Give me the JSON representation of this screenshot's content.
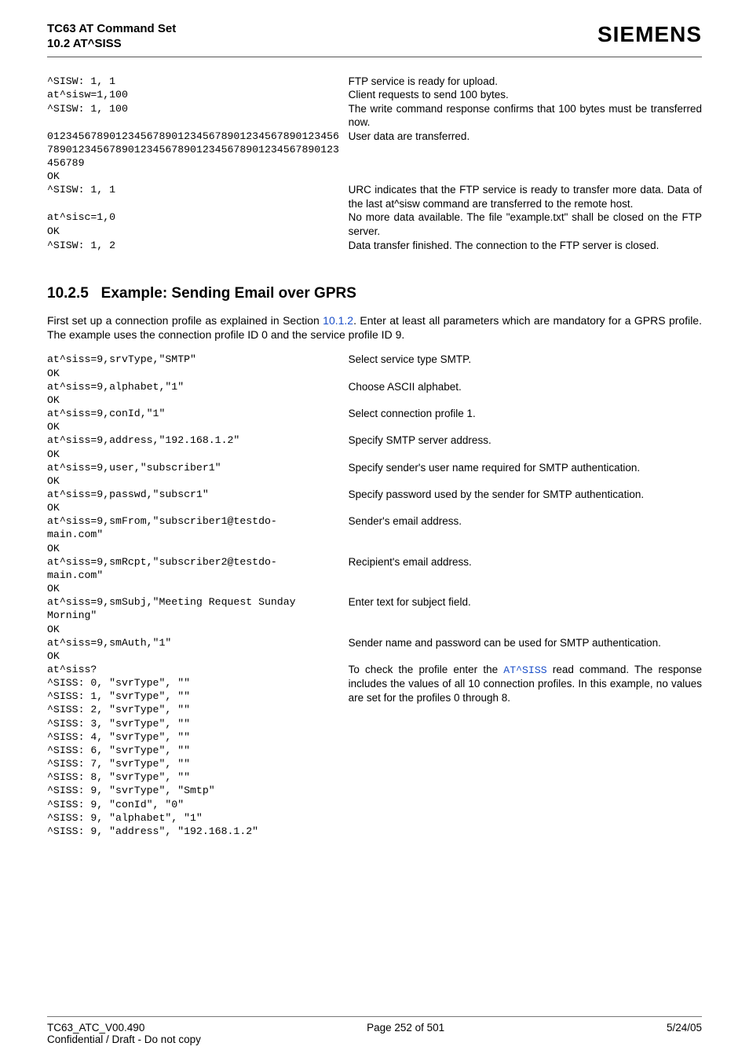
{
  "header": {
    "doc_title": "TC63 AT Command Set",
    "section_ref": "10.2 AT^SISS",
    "brand": "SIEMENS"
  },
  "block1_rows": [
    {
      "left": "^SISW: 1, 1",
      "right": "FTP service is ready for upload."
    },
    {
      "left": "at^sisw=1,100",
      "right": "Client requests to send 100 bytes."
    },
    {
      "left": "^SISW: 1, 100",
      "right": "The write command response confirms that 100 bytes must be transferred now."
    },
    {
      "left": "0123456789012345678901234567890123456789012345678901234567890123456789012345678901234567890123456789",
      "right": "User data are transferred."
    },
    {
      "left": "OK",
      "right": ""
    },
    {
      "left": "^SISW: 1, 1",
      "right": "URC indicates that the FTP service is ready to transfer more data. Data of the last at^sisw command are transferred to the remote host."
    },
    {
      "left": "at^sisc=1,0\nOK",
      "right": "No more data available. The file \"example.txt\" shall be closed on the FTP server."
    },
    {
      "left": "^SISW: 1, 2",
      "right": "Data transfer finished. The connection to the FTP server is closed."
    }
  ],
  "section": {
    "number": "10.2.5",
    "title": "Example: Sending Email over GPRS"
  },
  "intro_prefix": "First set up a connection profile as explained in Section ",
  "intro_link": "10.1.2",
  "intro_suffix": ". Enter at least all parameters which are mandatory for a GPRS profile. The example uses the connection profile ID 0 and the service profile ID 9.",
  "block2_rows": [
    {
      "left": "at^siss=9,srvType,\"SMTP\"\nOK",
      "right": "Select service type SMTP."
    },
    {
      "left": "at^siss=9,alphabet,\"1\"\nOK",
      "right": "Choose ASCII alphabet."
    },
    {
      "left": "at^siss=9,conId,\"1\"\nOK",
      "right": "Select connection profile 1."
    },
    {
      "left": "at^siss=9,address,\"192.168.1.2\"\nOK",
      "right": "Specify SMTP server address."
    },
    {
      "left": "at^siss=9,user,\"subscriber1\"\nOK",
      "right": "Specify sender's user name required for SMTP authentication."
    },
    {
      "left": "at^siss=9,passwd,\"subscr1\"\nOK",
      "right": "Specify password used by the sender for SMTP authentication."
    },
    {
      "left": "at^siss=9,smFrom,\"subscriber1@testdo-\nmain.com\"\nOK",
      "right": "Sender's email address."
    },
    {
      "left": "at^siss=9,smRcpt,\"subscriber2@testdo-\nmain.com\"\nOK",
      "right": "Recipient's email address."
    },
    {
      "left": "at^siss=9,smSubj,\"Meeting Request Sunday\nMorning\"\nOK",
      "right": "Enter text for subject field."
    },
    {
      "left": "at^siss=9,smAuth,\"1\"\nOK",
      "right": "Sender name and password can be used for SMTP authentication."
    }
  ],
  "siss_query_left": "at^siss?\n^SISS: 0, \"svrType\", \"\"\n^SISS: 1, \"svrType\", \"\"\n^SISS: 2, \"svrType\", \"\"\n^SISS: 3, \"svrType\", \"\"\n^SISS: 4, \"svrType\", \"\"\n^SISS: 6, \"svrType\", \"\"\n^SISS: 7, \"svrType\", \"\"\n^SISS: 8, \"svrType\", \"\"\n^SISS: 9, \"svrType\", \"Smtp\"\n^SISS: 9, \"conId\", \"0\"\n^SISS: 9, \"alphabet\", \"1\"\n^SISS: 9, \"address\", \"192.168.1.2\"",
  "siss_query_right_prefix": "To check the profile enter the ",
  "siss_query_right_link": "AT^SISS",
  "siss_query_right_suffix": " read command. The response includes the values of all 10 connection profiles. In this example, no values are set for the profiles 0 through 8.",
  "footer": {
    "left_line1": "TC63_ATC_V00.490",
    "left_line2": "Confidential / Draft - Do not copy",
    "center": "Page 252 of 501",
    "right": "5/24/05"
  }
}
